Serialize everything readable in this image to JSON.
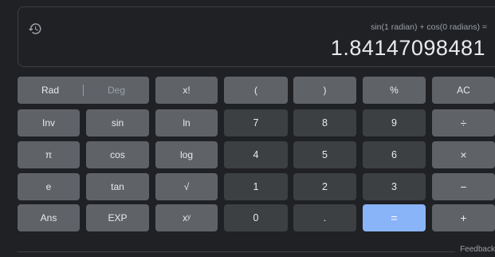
{
  "display": {
    "history_icon": "history-icon",
    "expression": "sin(1 radian) + cos(0 radians) =",
    "result": "1.84147098481"
  },
  "keys": {
    "rad": "Rad",
    "deg": "Deg",
    "factorial": "x!",
    "lparen": "(",
    "rparen": ")",
    "percent": "%",
    "ac": "AC",
    "inv": "Inv",
    "sin": "sin",
    "ln": "ln",
    "seven": "7",
    "eight": "8",
    "nine": "9",
    "divide": "÷",
    "pi": "π",
    "cos": "cos",
    "log": "log",
    "four": "4",
    "five": "5",
    "six": "6",
    "multiply": "×",
    "e": "e",
    "tan": "tan",
    "sqrt": "√",
    "one": "1",
    "two": "2",
    "three": "3",
    "minus": "−",
    "ans": "Ans",
    "exp": "EXP",
    "power": "xʸ",
    "zero": "0",
    "dot": ".",
    "equals": "=",
    "plus": "+"
  },
  "footer": {
    "feedback": "Feedback"
  },
  "colors": {
    "background": "#202124",
    "function_key": "#5f6368",
    "number_key": "#3c4043",
    "equals_key": "#8ab4f8",
    "text": "#e8eaed",
    "muted_text": "#9aa0a6"
  }
}
